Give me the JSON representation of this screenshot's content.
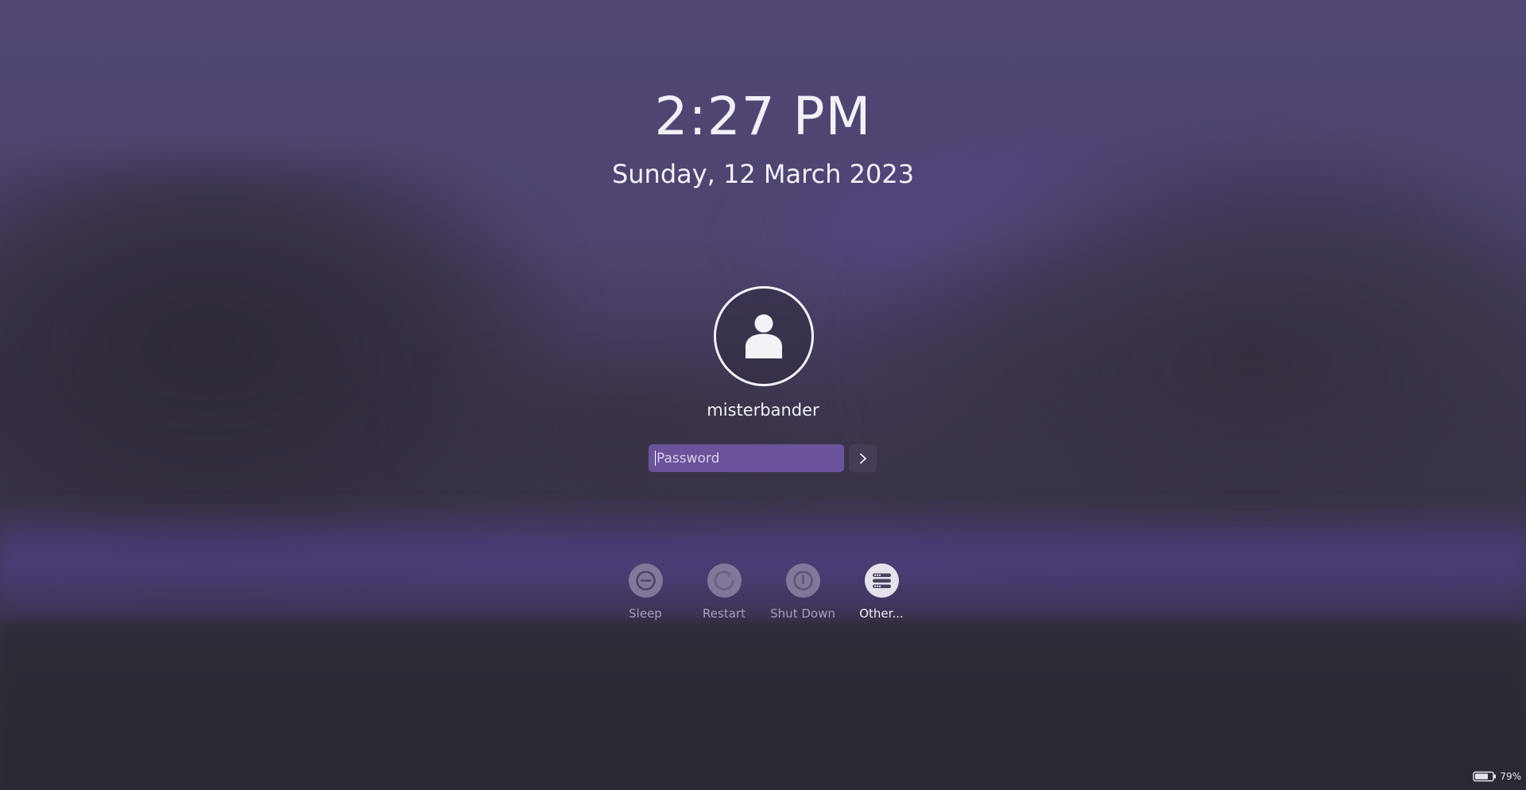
{
  "lock_screen": {
    "time": "2:27 PM",
    "date": "Sunday, 12 March 2023",
    "user": {
      "name": "misterbander",
      "avatar_icon": "user-silhouette-icon"
    },
    "password": {
      "placeholder": "Password",
      "value": "",
      "field_color": "#6a539b"
    },
    "submit_icon": "chevron-right-icon",
    "actions": [
      {
        "label": "Sleep",
        "icon": "sleep-icon",
        "active": false
      },
      {
        "label": "Restart",
        "icon": "restart-icon",
        "active": false
      },
      {
        "label": "Shut Down",
        "icon": "power-icon",
        "active": false
      },
      {
        "label": "Other...",
        "icon": "switch-user-icon",
        "active": true
      }
    ]
  },
  "system_tray": {
    "battery_icon": "battery-icon",
    "battery_percent": "79%"
  },
  "colors": {
    "accent": "#6a539b",
    "text": "#f2eff7",
    "muted_text": "#a7a0b8"
  }
}
